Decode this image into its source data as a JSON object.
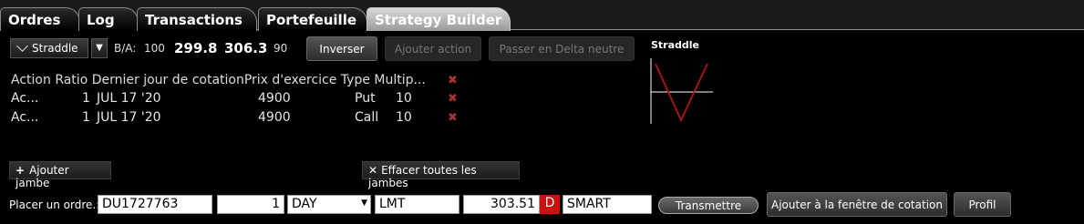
{
  "tabs": [
    {
      "label": "Ordres"
    },
    {
      "label": "Log"
    },
    {
      "label": "Transactions"
    },
    {
      "label": "Portefeuille"
    },
    {
      "label": "Strategy Builder",
      "active": true
    }
  ],
  "toolbar": {
    "strategy": "Straddle",
    "ba_label": "B/A:",
    "bid_size": "100",
    "bid": "299.8",
    "ask": "306.3",
    "ask_size": "90",
    "invert_label": "Inverser",
    "add_action_label": "Ajouter action",
    "delta_neutral_label": "Passer en Delta neutre"
  },
  "chart": {
    "title": "Straddle"
  },
  "legs": {
    "headers": [
      "Action",
      "Ratio",
      "Dernier jour de cotation",
      "Prix d'exercice",
      "Type",
      "Multip..."
    ],
    "rows": [
      {
        "action": "Ac...",
        "ratio": "1",
        "last_day": "JUL 17 '20",
        "strike": "4900",
        "type": "Put",
        "multiplier": "10"
      },
      {
        "action": "Ac...",
        "ratio": "1",
        "last_day": "JUL 17 '20",
        "strike": "4900",
        "type": "Call",
        "multiplier": "10"
      }
    ]
  },
  "actions": {
    "add_leg": "Ajouter jambe",
    "clear_legs": "Effacer toutes les jambes"
  },
  "order": {
    "label": "Placer un ordre.:",
    "account": "DU1727763",
    "quantity": "1",
    "tif": "DAY",
    "order_type": "LMT",
    "price": "303.51",
    "price_flag": "D",
    "route": "SMART",
    "transmit": "Transmettre",
    "add_quote": "Ajouter à la fenêtre de cotation",
    "profile": "Profil"
  },
  "colors": {
    "delete_x": "#aa3333",
    "payoff_line": "#a01818",
    "flag_red": "#cc1111"
  }
}
